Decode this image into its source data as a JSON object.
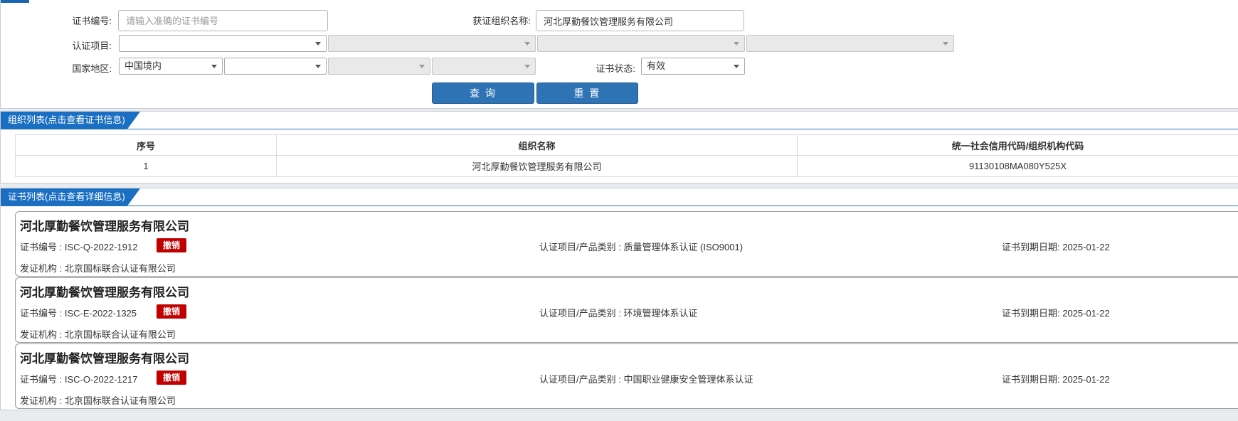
{
  "search": {
    "cert_no_label": "证书编号:",
    "cert_no_placeholder": "请输入准确的证书编号",
    "org_name_label": "获证组织名称:",
    "org_name_value": "河北厚勤餐饮管理服务有限公司",
    "cert_project_label": "认证项目:",
    "cert_project_value": "",
    "region_label": "国家地区:",
    "region_value": "中国境内",
    "status_label": "证书状态:",
    "status_value": "有效",
    "query_button": "查 询",
    "reset_button": "重 置"
  },
  "org_list": {
    "title": "组织列表(点击查看证书信息)",
    "columns": [
      "序号",
      "组织名称",
      "统一社会信用代码/组织机构代码"
    ],
    "rows": [
      {
        "index": "1",
        "name": "河北厚勤餐饮管理服务有限公司",
        "code": "91130108MA080Y525X"
      }
    ]
  },
  "cert_list": {
    "title": "证书列表(点击查看详细信息)",
    "cards": [
      {
        "org": "河北厚勤餐饮管理服务有限公司",
        "cert_no": "证书编号 : ISC-Q-2022-1912",
        "status_badge": "撤销",
        "project": "认证项目/产品类别 : 质量管理体系认证 (ISO9001)",
        "expiry": "证书到期日期: 2025-01-22",
        "issuer": "发证机构 : 北京国标联合认证有限公司"
      },
      {
        "org": "河北厚勤餐饮管理服务有限公司",
        "cert_no": "证书编号 : ISC-E-2022-1325",
        "status_badge": "撤销",
        "project": "认证项目/产品类别 : 环境管理体系认证",
        "expiry": "证书到期日期: 2025-01-22",
        "issuer": "发证机构 : 北京国标联合认证有限公司"
      },
      {
        "org": "河北厚勤餐饮管理服务有限公司",
        "cert_no": "证书编号 : ISC-O-2022-1217",
        "status_badge": "撤销",
        "project": "认证项目/产品类别 : 中国职业健康安全管理体系认证",
        "expiry": "证书到期日期: 2025-01-22",
        "issuer": "发证机构 : 北京国标联合认证有限公司"
      }
    ]
  },
  "colors": {
    "primary_button": "#2e74b5",
    "section_tab": "#1a6fc2",
    "revoked_badge": "#c00000"
  }
}
